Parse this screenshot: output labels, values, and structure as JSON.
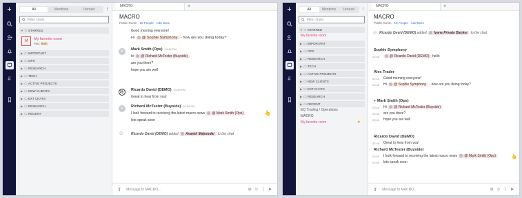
{
  "sidebar_tabs": [
    "All",
    "Mentions",
    "Unread"
  ],
  "filter_placeholder": "Filter chats",
  "left": {
    "sections_top": "STARRED",
    "favorite": {
      "name": "My favorite room",
      "sub_prefix": "You:",
      "sub_tag": "Tech",
      "badge": "M"
    },
    "sections": [
      "IMPORTANT",
      "OPS",
      "RESEARCH",
      "TECH",
      "ACTIVE PROJECTS",
      "NEW CLIENTS",
      "EXT CHATS",
      "RESEARCH",
      "RECENT"
    ],
    "tab_title": "MACRO",
    "room_title": "MACRO",
    "room_sub_prefix": "Public Room",
    "room_people": "18 People",
    "room_add": "Add More",
    "messages": [
      {
        "line": "Good morning everyone!"
      },
      {
        "mention": "@ Sophie Symphony",
        "text": "- how are you doing today?",
        "prefix": "Hi"
      },
      {
        "name": "Mark Smith (Ops)",
        "time": "03:48 PM",
        "prefix": "hi",
        "mention": "@ Richard McTester (Buyside)"
      },
      {
        "line": "are you there?"
      },
      {
        "line": "hope you are well"
      },
      {
        "name": "Ricardo David (DEMO)",
        "time": "03:48 PM",
        "line": "Great to hear from you!"
      },
      {
        "name": "Richard McTester (Buyside)",
        "time": "03:55 PM",
        "text": "I look forward to receiving the latest macro news",
        "mention": "@ Mark Smith (Ops)"
      },
      {
        "line": "lets speak soon"
      },
      {
        "sys_name": "Ricardo David (DEMO)",
        "sys_mid": "added",
        "sys_user": "Ananth Majumdar",
        "sys_end": "to the chat"
      }
    ],
    "composer": "Message to MACRO..."
  },
  "right": {
    "sections_top": "STARRED",
    "favorite": "My favorite room",
    "sections": [
      "IMPORTANT",
      "OPS",
      "RESEARCH",
      "TECH",
      "ACTIVE PROJECTS",
      "NEW CLIENTS",
      "EXT CHATS",
      "RESEARCH",
      "RECENT"
    ],
    "recent_items": [
      "EQ Trading / Operations",
      "MACRO",
      "My favorite room"
    ],
    "tab_title": "MACRO",
    "room_title": "MACRO",
    "room_sub_prefix": "Public Room",
    "room_people": "18 People",
    "room_add": "Add More",
    "sys_top": {
      "name": "Ricardo David (DEMO)",
      "mid": "added",
      "user": "Ivana Private Banker",
      "end": "to the chat"
    },
    "messages": [
      {
        "name": "Sophie Symphony",
        "time": "03:48",
        "text": "hello",
        "mention": "@ Ricardo David (DEMO)"
      },
      {
        "name": "Alex Trader",
        "t1": "03:48",
        "l1": "Good morning everyone!",
        "t2": "03:48",
        "prefix": "Hi",
        "mention": "@ Sophie Symphony",
        "text": "- how are you doing today?"
      },
      {
        "name": "Mark Smith (Ops)",
        "t1": "03:48",
        "prefix": "Hi",
        "mention": "@ Richard McTester (Buyside)",
        "t2": "03:48",
        "l2": "are you there?",
        "t3": "03:48",
        "l3": "hope you are well"
      },
      {
        "name": "Ricardo David (DEMO)",
        "t1": "03:48",
        "l1": "Great to hear from you!"
      },
      {
        "name": "Richard McTester (Buyside)",
        "t1": "03:55",
        "l1": "I look forward to receiving the latest macro news",
        "mention": "@ Mark Smith (Ops)",
        "t2": "03:55",
        "l2": "lets speak soon"
      }
    ],
    "composer": "Message to MACRO..."
  }
}
